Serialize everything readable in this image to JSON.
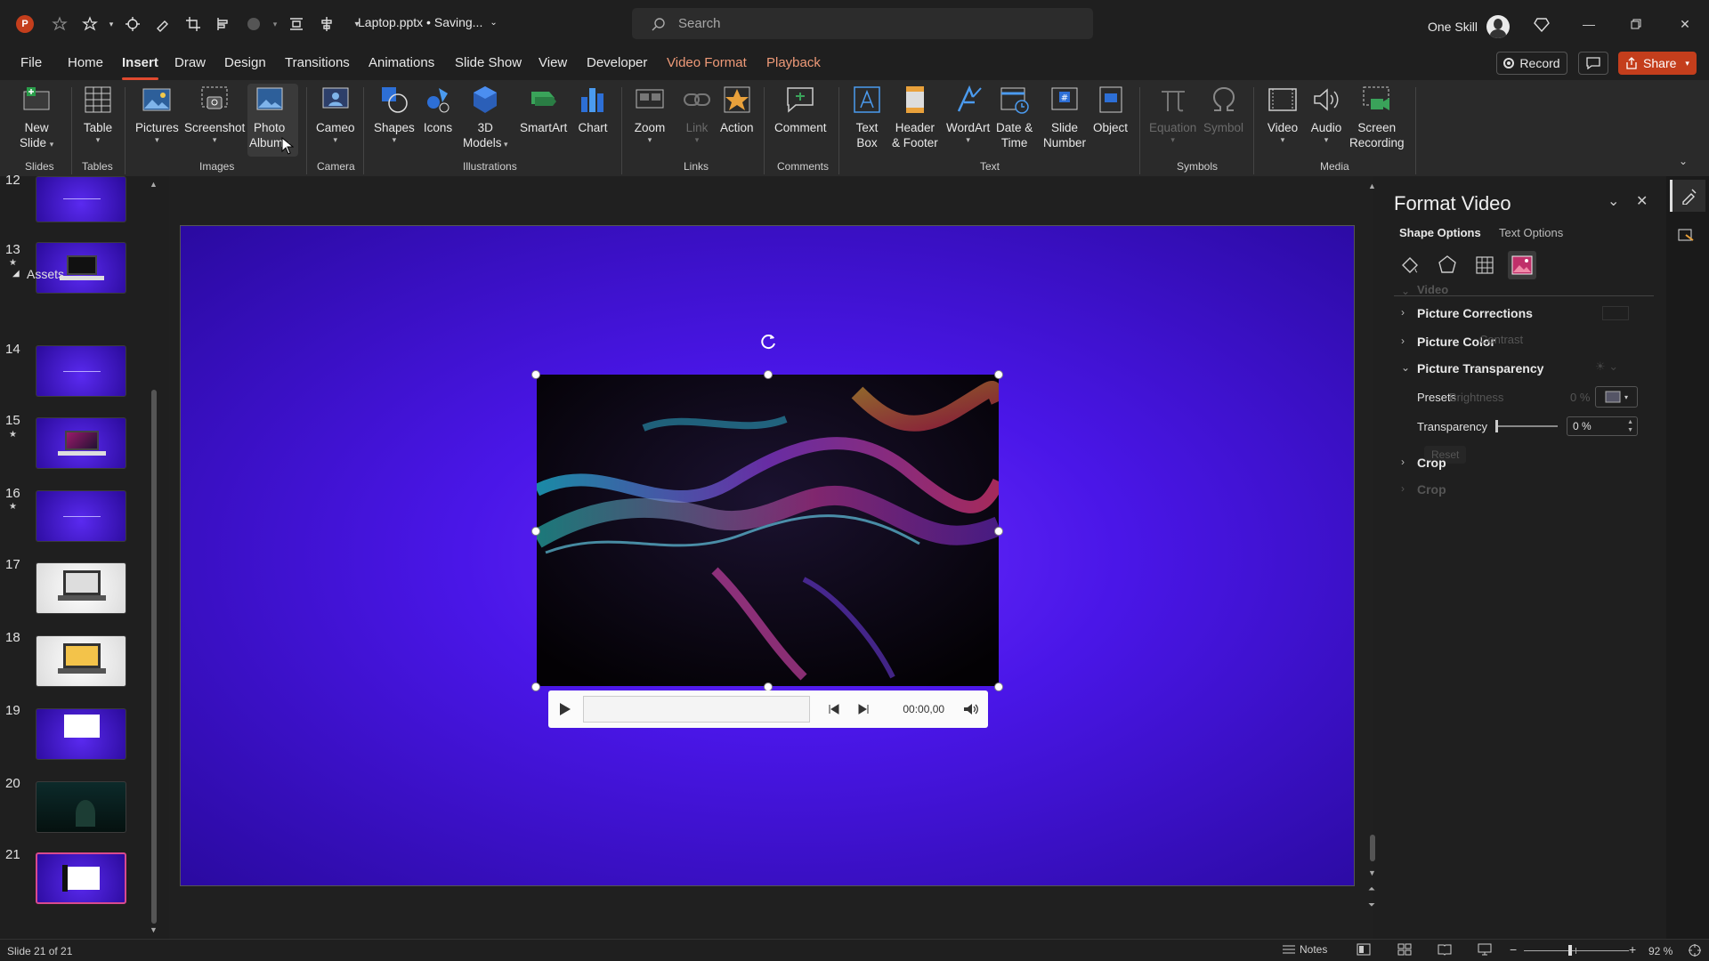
{
  "app": {
    "filename": "Laptop.pptx • Saving...",
    "search_placeholder": "Search",
    "account_name": "One Skill"
  },
  "menu_tabs": [
    {
      "label": "File"
    },
    {
      "label": "Home"
    },
    {
      "label": "Insert"
    },
    {
      "label": "Draw"
    },
    {
      "label": "Design"
    },
    {
      "label": "Transitions"
    },
    {
      "label": "Animations"
    },
    {
      "label": "Slide Show"
    },
    {
      "label": "View"
    },
    {
      "label": "Developer"
    },
    {
      "label": "Video Format"
    },
    {
      "label": "Playback"
    }
  ],
  "top_buttons": {
    "record": "Record",
    "share": "Share"
  },
  "ribbon": {
    "buttons": [
      {
        "l1": "New",
        "l2": "Slide"
      },
      {
        "l1": "Table",
        "l2": ""
      },
      {
        "l1": "Pictures",
        "l2": ""
      },
      {
        "l1": "Screenshot",
        "l2": ""
      },
      {
        "l1": "Photo",
        "l2": "Album"
      },
      {
        "l1": "Cameo",
        "l2": ""
      },
      {
        "l1": "Shapes",
        "l2": ""
      },
      {
        "l1": "Icons",
        "l2": ""
      },
      {
        "l1": "3D",
        "l2": "Models"
      },
      {
        "l1": "SmartArt",
        "l2": ""
      },
      {
        "l1": "Chart",
        "l2": ""
      },
      {
        "l1": "Zoom",
        "l2": ""
      },
      {
        "l1": "Link",
        "l2": ""
      },
      {
        "l1": "Action",
        "l2": ""
      },
      {
        "l1": "Comment",
        "l2": ""
      },
      {
        "l1": "Text",
        "l2": "Box"
      },
      {
        "l1": "Header",
        "l2": "& Footer"
      },
      {
        "l1": "WordArt",
        "l2": ""
      },
      {
        "l1": "Date &",
        "l2": "Time"
      },
      {
        "l1": "Slide",
        "l2": "Number"
      },
      {
        "l1": "Object",
        "l2": ""
      },
      {
        "l1": "Equation",
        "l2": ""
      },
      {
        "l1": "Symbol",
        "l2": ""
      },
      {
        "l1": "Video",
        "l2": ""
      },
      {
        "l1": "Audio",
        "l2": ""
      },
      {
        "l1": "Screen",
        "l2": "Recording"
      }
    ],
    "groups": [
      "Slides",
      "Tables",
      "Images",
      "Camera",
      "Illustrations",
      "Links",
      "Comments",
      "Text",
      "Symbols",
      "Media"
    ]
  },
  "thumbnails": {
    "section_label": "Assets",
    "slides": [
      {
        "num": "12",
        "starred": false
      },
      {
        "num": "13",
        "starred": true
      },
      {
        "num": "14",
        "starred": false
      },
      {
        "num": "15",
        "starred": true
      },
      {
        "num": "16",
        "starred": true
      },
      {
        "num": "17",
        "starred": false
      },
      {
        "num": "18",
        "starred": false
      },
      {
        "num": "19",
        "starred": false
      },
      {
        "num": "20",
        "starred": false
      },
      {
        "num": "21",
        "starred": false
      }
    ]
  },
  "video_player": {
    "time": "00:00,00"
  },
  "format_pane": {
    "title": "Format Video",
    "tab_shape": "Shape Options",
    "tab_text": "Text Options",
    "sections": {
      "video": "Video",
      "corrections": "Picture Corrections",
      "color": "Picture Color",
      "transparency": "Picture Transparency",
      "crop": "Crop",
      "crop_ghost": "Crop"
    },
    "presets_label": "Presets",
    "transparency_label": "Transparency",
    "transparency_value": "0 %",
    "ghost_value": "0 %",
    "ghost_brightness": "Brightness",
    "ghost_contrast": "Contrast",
    "ghost_reset": "Reset"
  },
  "statusbar": {
    "slide_info": "Slide 21 of 21",
    "notes": "Notes",
    "zoom": "92 %"
  }
}
